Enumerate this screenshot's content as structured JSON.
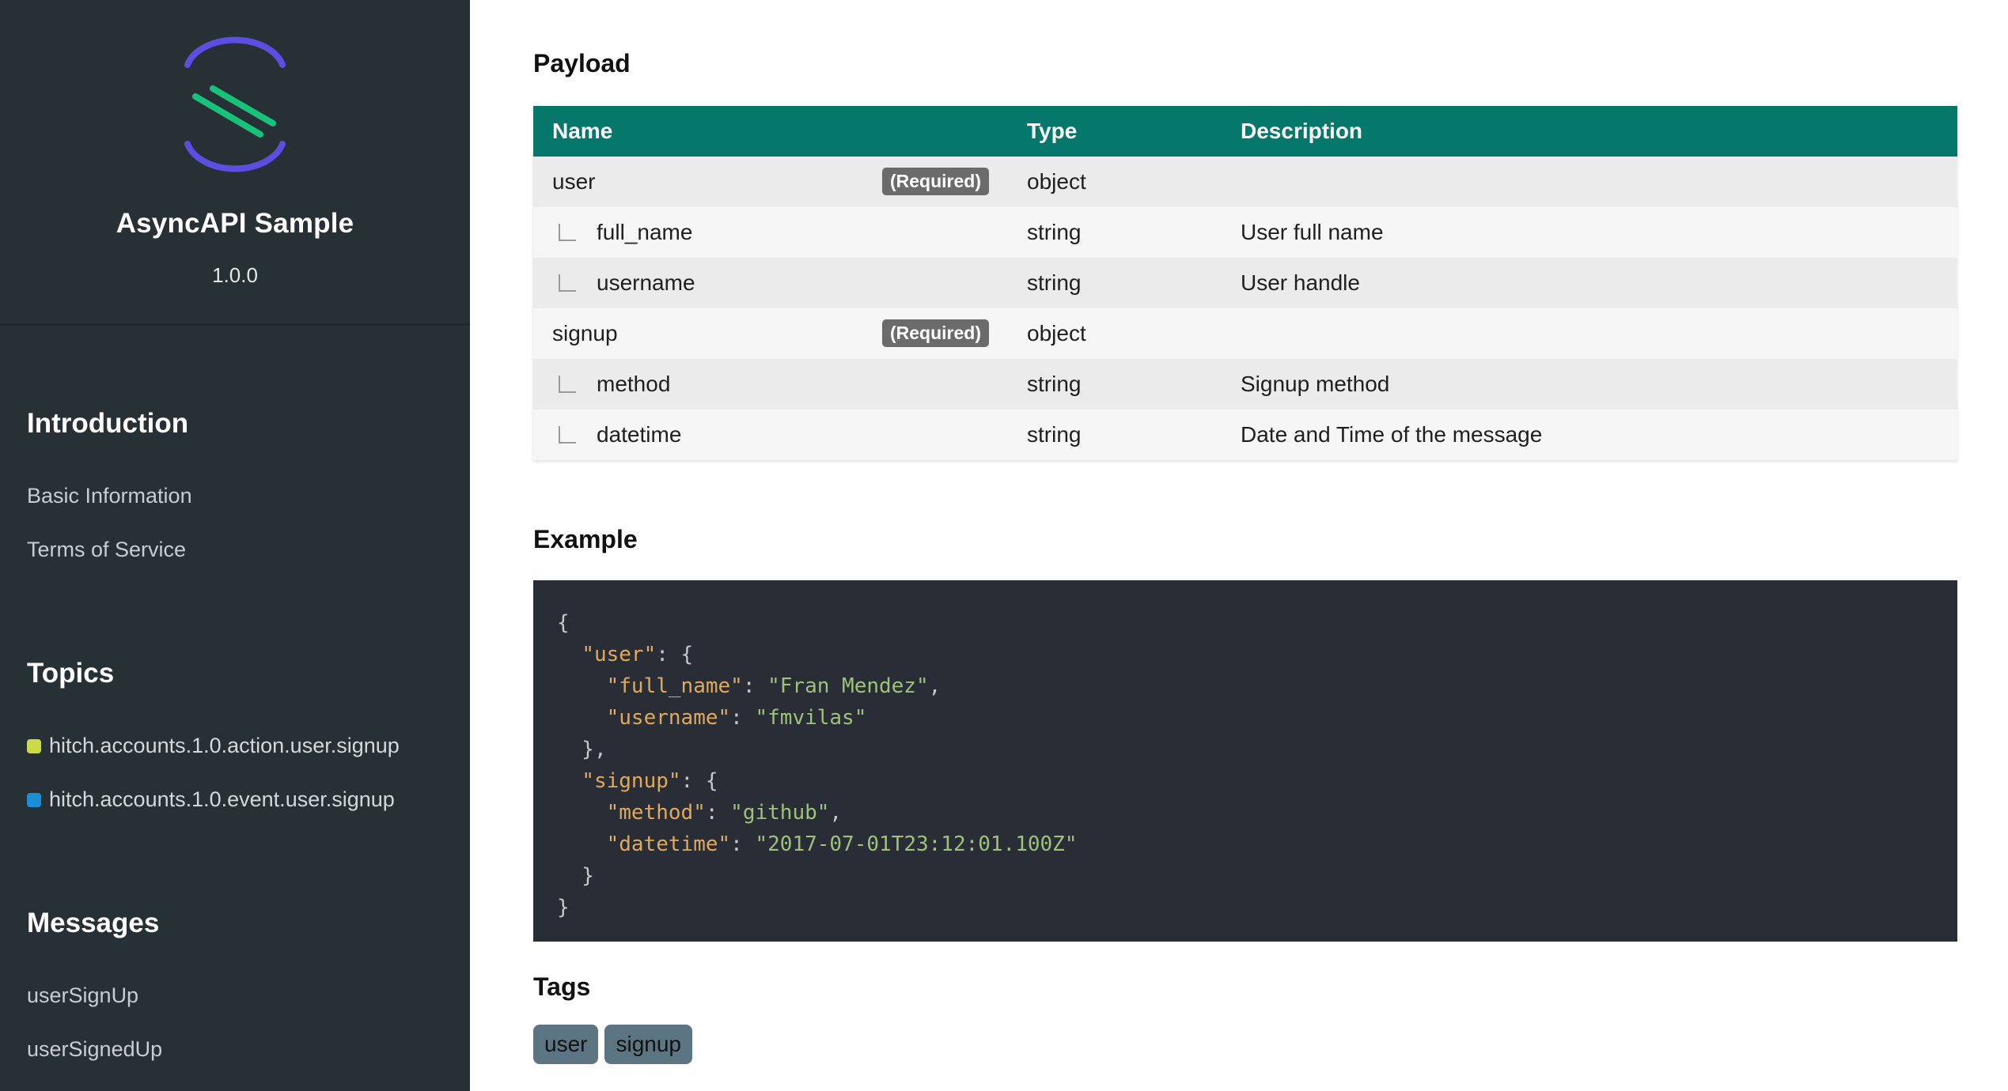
{
  "sidebar": {
    "title": "AsyncAPI Sample",
    "version": "1.0.0",
    "introduction": {
      "heading": "Introduction",
      "items": [
        "Basic Information",
        "Terms of Service"
      ]
    },
    "topics": {
      "heading": "Topics",
      "items": [
        {
          "label": "hitch.accounts.1.0.action.user.signup",
          "color": "#c9dc48"
        },
        {
          "label": "hitch.accounts.1.0.event.user.signup",
          "color": "#1a8fd8"
        }
      ]
    },
    "messages": {
      "heading": "Messages",
      "items": [
        "userSignUp",
        "userSignedUp"
      ]
    }
  },
  "payload": {
    "title": "Payload",
    "columns": [
      "Name",
      "Type",
      "Description"
    ],
    "required_label": "(Required)",
    "rows": [
      {
        "name": "user",
        "type": "object",
        "description": "",
        "required": true,
        "child": false
      },
      {
        "name": "full_name",
        "type": "string",
        "description": "User full name",
        "required": false,
        "child": true
      },
      {
        "name": "username",
        "type": "string",
        "description": "User handle",
        "required": false,
        "child": true
      },
      {
        "name": "signup",
        "type": "object",
        "description": "",
        "required": true,
        "child": false
      },
      {
        "name": "method",
        "type": "string",
        "description": "Signup method",
        "required": false,
        "child": true
      },
      {
        "name": "datetime",
        "type": "string",
        "description": "Date and Time of the message",
        "required": false,
        "child": true
      }
    ]
  },
  "example": {
    "title": "Example",
    "lines": [
      [
        [
          "p",
          "{"
        ]
      ],
      [
        [
          "p",
          "  "
        ],
        [
          "k",
          "\"user\""
        ],
        [
          "p",
          ": {"
        ]
      ],
      [
        [
          "p",
          "    "
        ],
        [
          "k",
          "\"full_name\""
        ],
        [
          "p",
          ": "
        ],
        [
          "s",
          "\"Fran Mendez\""
        ],
        [
          "p",
          ","
        ]
      ],
      [
        [
          "p",
          "    "
        ],
        [
          "k",
          "\"username\""
        ],
        [
          "p",
          ": "
        ],
        [
          "s",
          "\"fmvilas\""
        ]
      ],
      [
        [
          "p",
          "  },"
        ]
      ],
      [
        [
          "p",
          "  "
        ],
        [
          "k",
          "\"signup\""
        ],
        [
          "p",
          ": {"
        ]
      ],
      [
        [
          "p",
          "    "
        ],
        [
          "k",
          "\"method\""
        ],
        [
          "p",
          ": "
        ],
        [
          "s",
          "\"github\""
        ],
        [
          "p",
          ","
        ]
      ],
      [
        [
          "p",
          "    "
        ],
        [
          "k",
          "\"datetime\""
        ],
        [
          "p",
          ": "
        ],
        [
          "s",
          "\"2017-07-01T23:12:01.100Z\""
        ]
      ],
      [
        [
          "p",
          "  }"
        ]
      ],
      [
        [
          "p",
          "}"
        ]
      ]
    ]
  },
  "tags": {
    "title": "Tags",
    "items": [
      "user",
      "signup"
    ]
  }
}
